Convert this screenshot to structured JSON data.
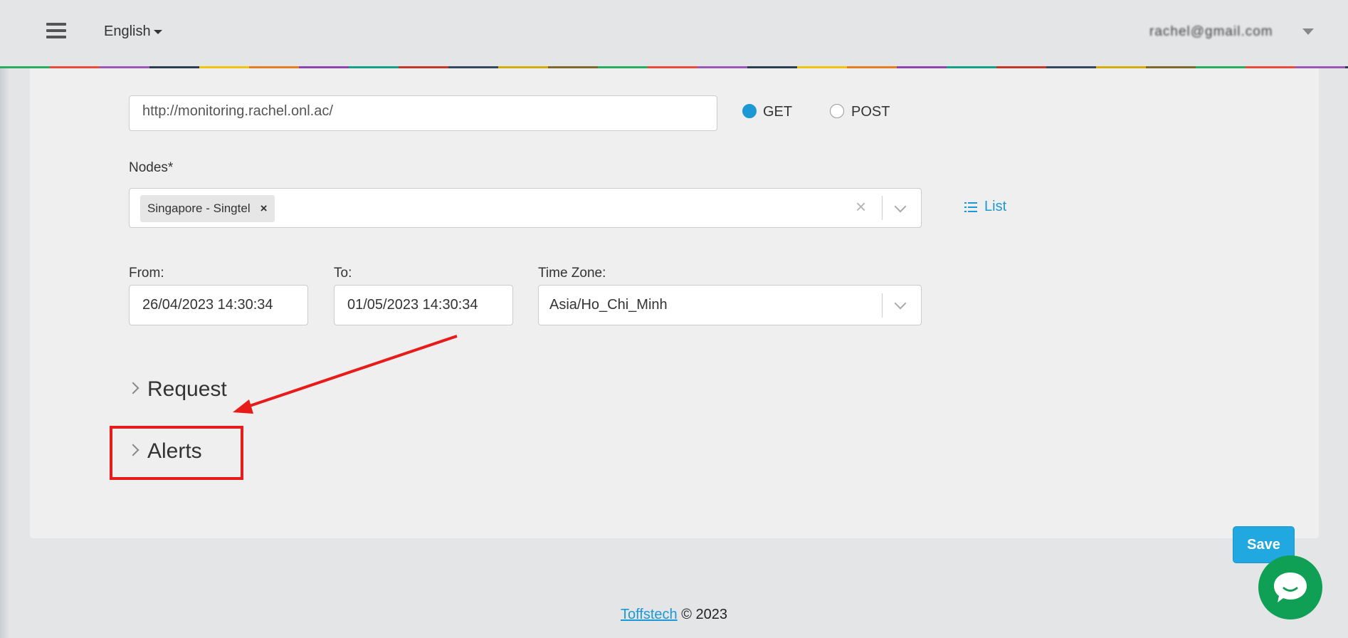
{
  "header": {
    "language": "English",
    "user_email": "rachel@gmail.com"
  },
  "form": {
    "url_value": "http://monitoring.rachel.onl.ac/",
    "method_options": [
      "GET",
      "POST"
    ],
    "method_selected": "GET",
    "nodes_label": "Nodes*",
    "nodes_selected": [
      "Singapore - Singtel"
    ],
    "list_label": "List",
    "from_label": "From:",
    "from_value": "26/04/2023 14:30:34",
    "to_label": "To:",
    "to_value": "01/05/2023 14:30:34",
    "timezone_label": "Time Zone:",
    "timezone_value": "Asia/Ho_Chi_Minh"
  },
  "sections": {
    "request": "Request",
    "alerts": "Alerts"
  },
  "actions": {
    "save": "Save"
  },
  "footer": {
    "company": "Toffstech",
    "copyright": "© 2023"
  },
  "colors": {
    "accent": "#1c98d4",
    "save_button": "#22a8e0",
    "annotation_red": "#e81b1b",
    "chat_green": "#0fa055"
  },
  "icons": {
    "menu": "hamburger-icon",
    "list": "list-icon",
    "chat": "chat-bubble-icon"
  }
}
